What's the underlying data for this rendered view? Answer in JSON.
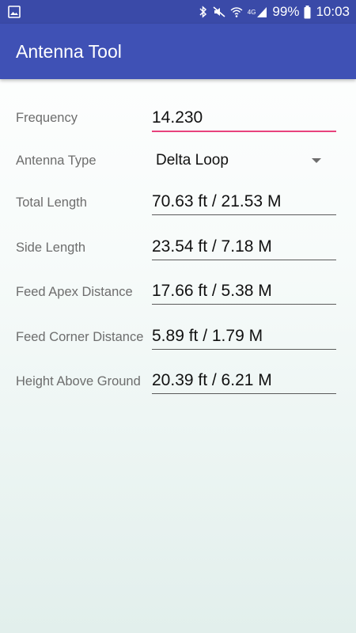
{
  "status_bar": {
    "battery_percent": "99%",
    "time": "10:03",
    "network_label": "4G"
  },
  "app_bar": {
    "title": "Antenna Tool"
  },
  "form": {
    "frequency": {
      "label": "Frequency",
      "value": "14.230"
    },
    "antenna_type": {
      "label": "Antenna Type",
      "value": "Delta Loop"
    },
    "total_length": {
      "label": "Total Length",
      "value": "70.63 ft / 21.53 M"
    },
    "side_length": {
      "label": "Side Length",
      "value": "23.54 ft / 7.18 M"
    },
    "feed_apex_distance": {
      "label": "Feed Apex Distance",
      "value": "17.66 ft / 5.38 M"
    },
    "feed_corner_distance": {
      "label": "Feed Corner Distance",
      "value": "5.89 ft / 1.79 M"
    },
    "height_above_ground": {
      "label": "Height Above Ground",
      "value": "20.39 ft / 6.21 M"
    }
  },
  "colors": {
    "status_bar": "#3a4aa8",
    "app_bar": "#3f51b5",
    "accent_underline": "#e8427c"
  }
}
